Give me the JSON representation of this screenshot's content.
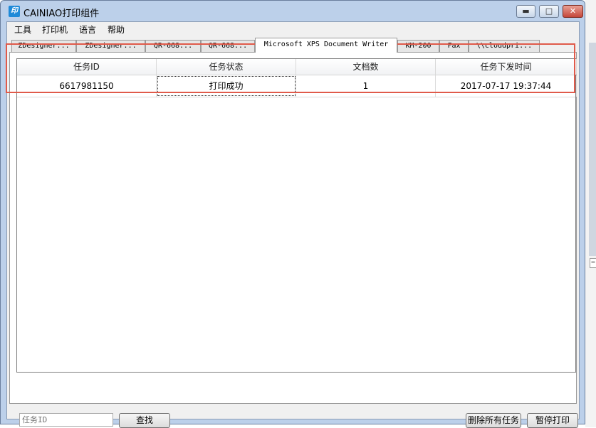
{
  "window": {
    "title": "CAINIAO打印组件",
    "icon": "cainiao-app-icon",
    "icon_text": "印"
  },
  "window_controls": {
    "minimize": "▬",
    "maximize": "□",
    "close": "✕"
  },
  "menu": [
    "工具",
    "打印机",
    "语言",
    "帮助"
  ],
  "tabs": [
    "ZDesigner...",
    "ZDesigner...",
    "QR-668...",
    "QR-668...",
    "Microsoft XPS Document Writer",
    "KM-200",
    "Fax",
    "\\\\cloudpri..."
  ],
  "active_tab_index": 4,
  "table": {
    "columns": [
      "任务ID",
      "任务状态",
      "文档数",
      "任务下发时间"
    ],
    "rows": [
      [
        "6617981150",
        "打印成功",
        "1",
        "2017-07-17 19:37:44"
      ]
    ]
  },
  "search": {
    "placeholder": "任务ID",
    "button": "查找"
  },
  "actions": {
    "delete_all": "删除所有任务",
    "pause_print": "暂停打印"
  },
  "colors": {
    "highlight_border": "#e05a4a",
    "frame": "#bcd0ea"
  }
}
